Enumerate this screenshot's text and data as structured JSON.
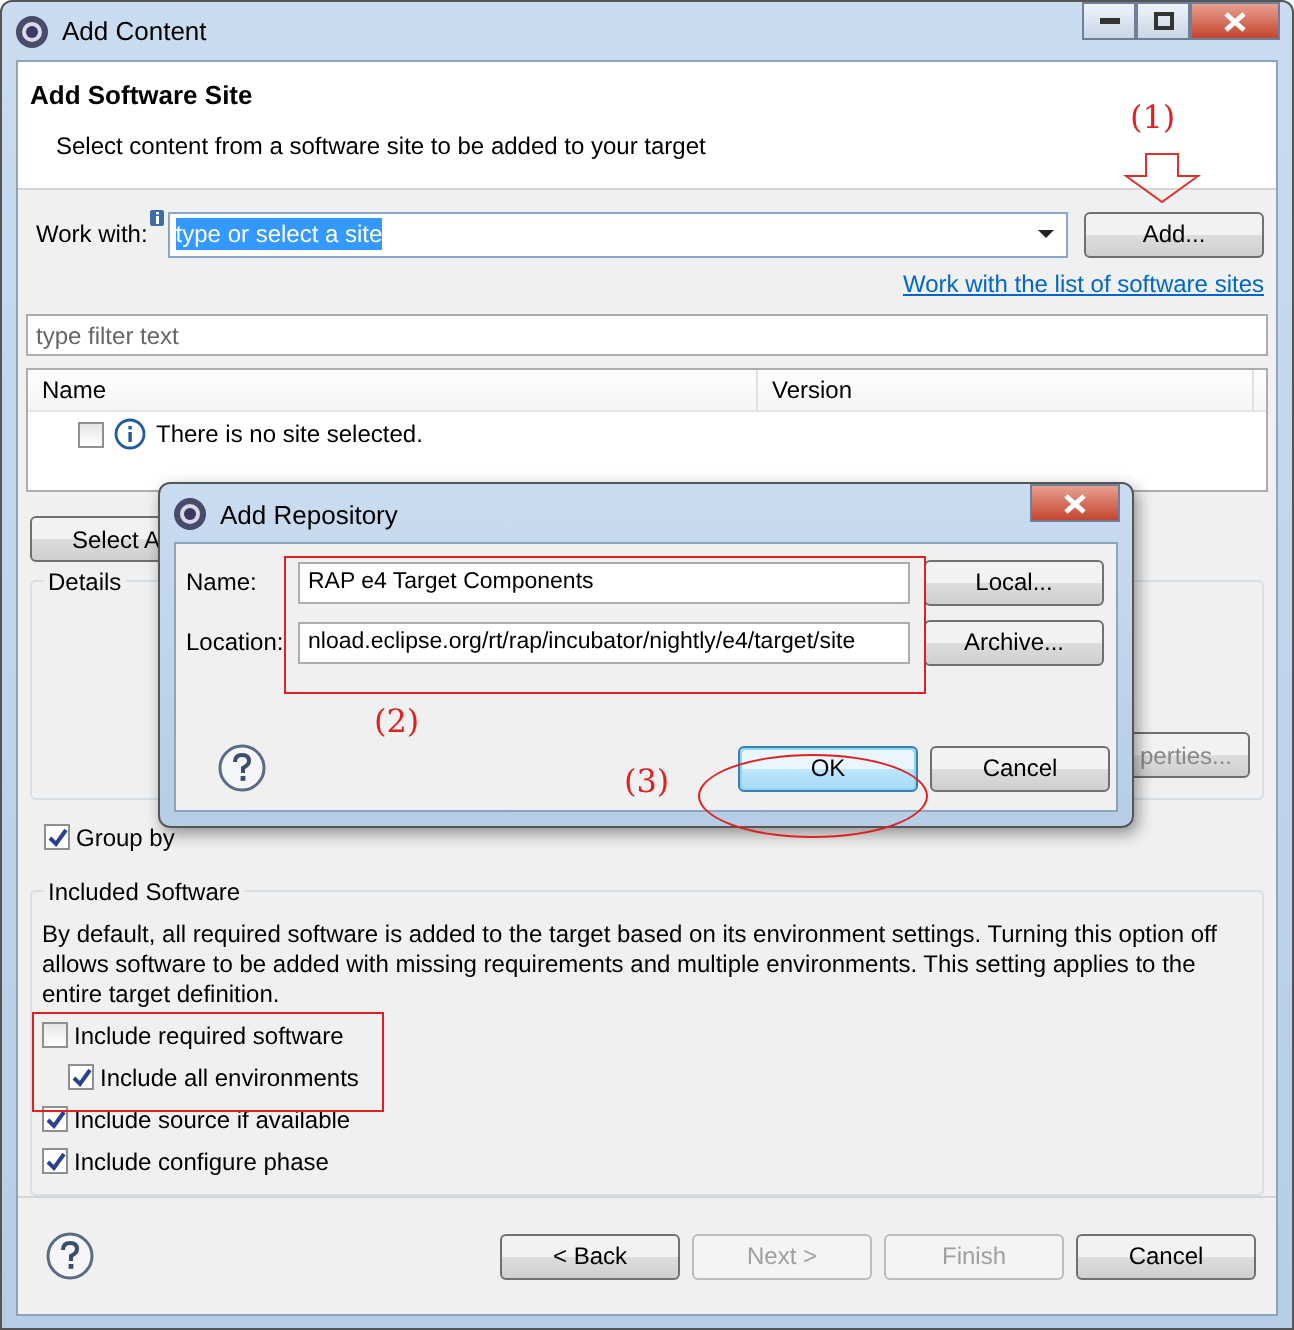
{
  "window": {
    "title": "Add Content"
  },
  "header": {
    "title": "Add Software Site",
    "description": "Select content from a software site to be added to your target"
  },
  "work_with": {
    "label": "Work with:",
    "value": "type or select a site",
    "add_button": "Add...",
    "link": "Work with the list of software sites"
  },
  "filter": {
    "placeholder": "type filter text"
  },
  "table": {
    "columns": [
      "Name",
      "Version"
    ],
    "rows": [
      {
        "checked": false,
        "text": "There is no site selected."
      }
    ]
  },
  "select_all_button": "Select A",
  "details": {
    "label": "Details",
    "properties_button": "perties..."
  },
  "group_by": {
    "label": "Group by",
    "checked": true
  },
  "included_software": {
    "label": "Included Software",
    "description": "By default, all required software is added to the target based on its environment settings. Turning this option off allows software to be added with missing requirements and multiple environments.  This setting applies to the entire target definition.",
    "options": [
      {
        "label": "Include required software",
        "checked": false,
        "children": [
          {
            "label": "Include all environments",
            "checked": true
          }
        ]
      },
      {
        "label": "Include source if available",
        "checked": true
      },
      {
        "label": "Include configure phase",
        "checked": true
      }
    ]
  },
  "footer": {
    "buttons": [
      {
        "label": "< Back",
        "disabled": false
      },
      {
        "label": "Next >",
        "disabled": true
      },
      {
        "label": "Finish",
        "disabled": true
      },
      {
        "label": "Cancel",
        "disabled": false
      }
    ]
  },
  "dialog": {
    "title": "Add Repository",
    "fields": [
      {
        "label": "Name:",
        "value": "RAP e4 Target Components",
        "button": "Local..."
      },
      {
        "label": "Location:",
        "value": "nload.eclipse.org/rt/rap/incubator/nightly/e4/target/site",
        "button": "Archive..."
      }
    ],
    "buttons": [
      {
        "label": "OK",
        "default": true
      },
      {
        "label": "Cancel",
        "default": false
      }
    ]
  },
  "annotations": [
    "(1)",
    "(2)",
    "(3)"
  ]
}
